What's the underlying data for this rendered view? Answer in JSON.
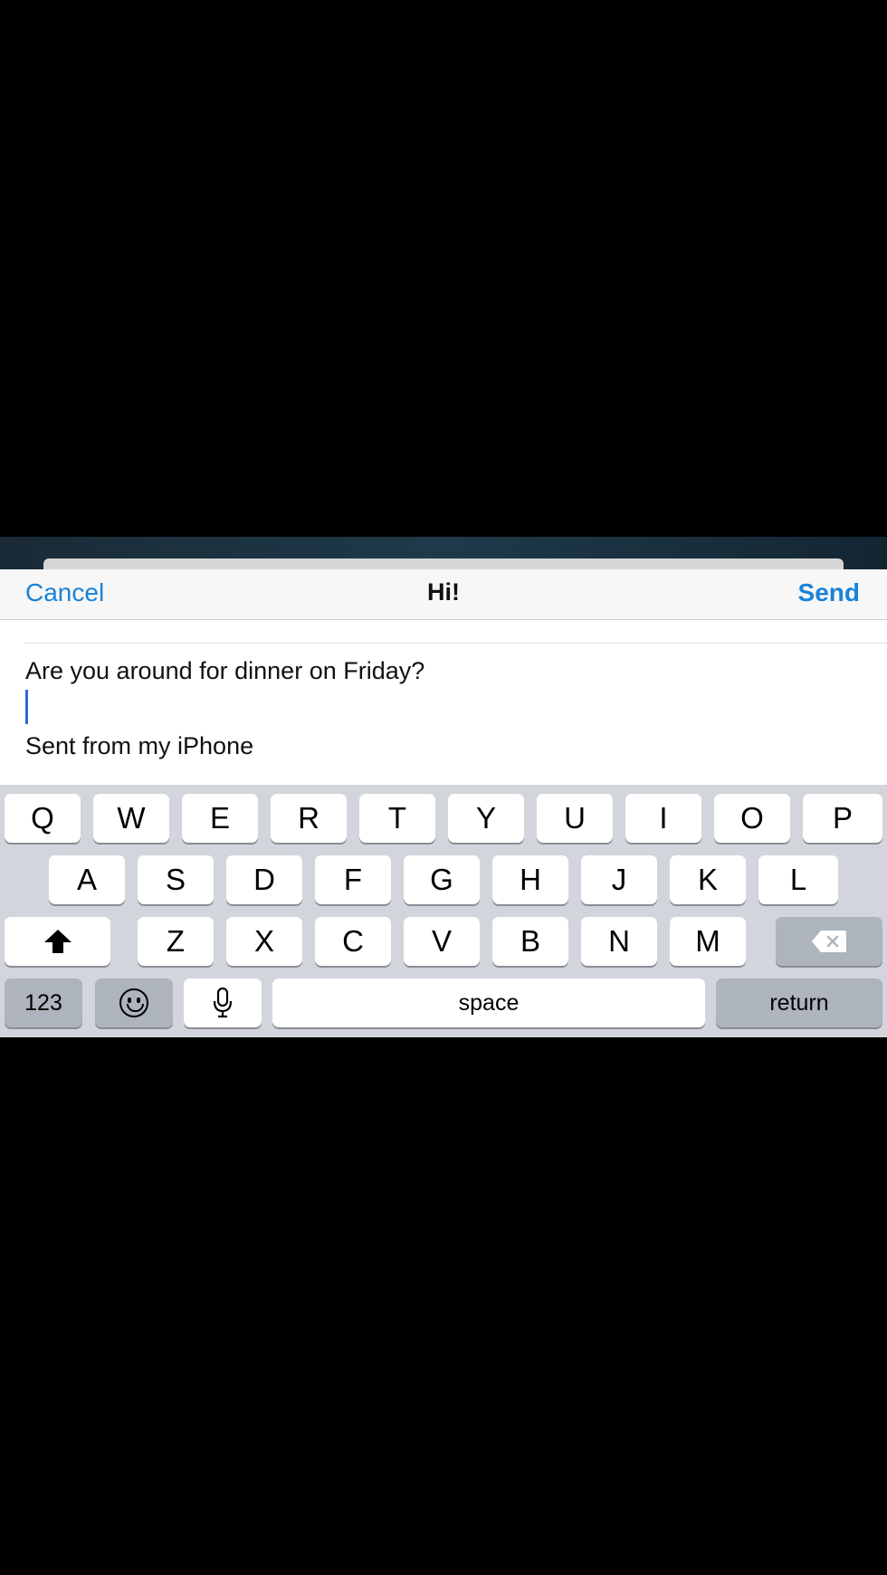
{
  "compose": {
    "cancel_label": "Cancel",
    "title": "Hi!",
    "send_label": "Send",
    "body_line1": "Are you around for dinner on Friday?",
    "signature": "Sent from my iPhone"
  },
  "keyboard": {
    "row1": [
      "Q",
      "W",
      "E",
      "R",
      "T",
      "Y",
      "U",
      "I",
      "O",
      "P"
    ],
    "row2": [
      "A",
      "S",
      "D",
      "F",
      "G",
      "H",
      "J",
      "K",
      "L"
    ],
    "row3": [
      "Z",
      "X",
      "C",
      "V",
      "B",
      "N",
      "M"
    ],
    "numbers_label": "123",
    "space_label": "space",
    "return_label": "return",
    "shift_icon": "shift-icon",
    "backspace_icon": "backspace-icon",
    "emoji_icon": "emoji-icon",
    "mic_icon": "microphone-icon"
  },
  "colors": {
    "accent": "#1a82d8",
    "keyboard_bg": "#d2d5db",
    "key_bg": "#ffffff",
    "function_key_bg": "#adb4be"
  }
}
